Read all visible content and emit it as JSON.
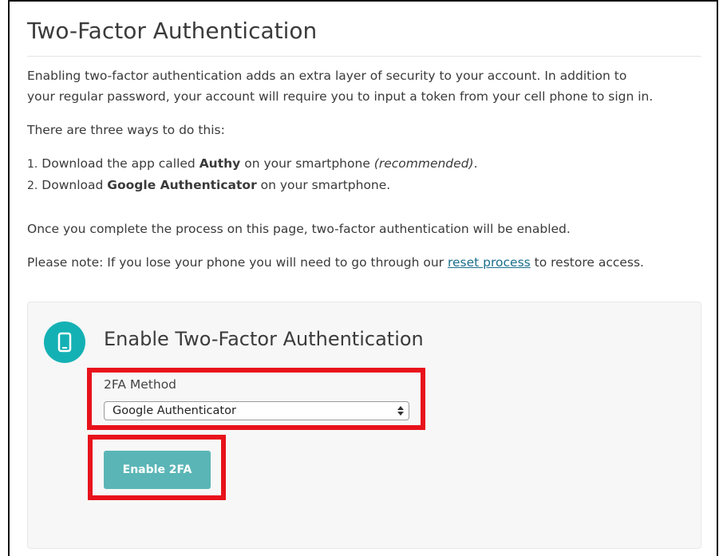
{
  "page": {
    "title": "Two-Factor Authentication",
    "intro_line1": "Enabling two-factor authentication adds an extra layer of security to your account. In addition to",
    "intro_line2": "your regular password, your account will require you to input a token from your cell phone to sign in.",
    "ways_text": "There are three ways to do this:",
    "list": [
      {
        "number": "1.",
        "before": "Download the app called ",
        "bold": "Authy",
        "after": " on your smartphone ",
        "italic": "(recommended)",
        "end": "."
      },
      {
        "number": "2.",
        "before": "Download ",
        "bold": "Google Authenticator",
        "after": " on your smartphone."
      }
    ],
    "once_text": "Once you complete the process on this page, two-factor authentication will be enabled.",
    "note_before": "Please note: If you lose your phone you will need to go through our ",
    "note_link": "reset process",
    "note_after": " to restore access."
  },
  "card": {
    "icon": "smartphone-icon",
    "title": "Enable Two-Factor Authentication",
    "method_label": "2FA Method",
    "method_selected": "Google Authenticator",
    "button_label": "Enable 2FA"
  },
  "colors": {
    "accent": "#14b1b4",
    "button": "#5ab5b6",
    "highlight": "#e8121b",
    "link": "#1a6f8c"
  }
}
